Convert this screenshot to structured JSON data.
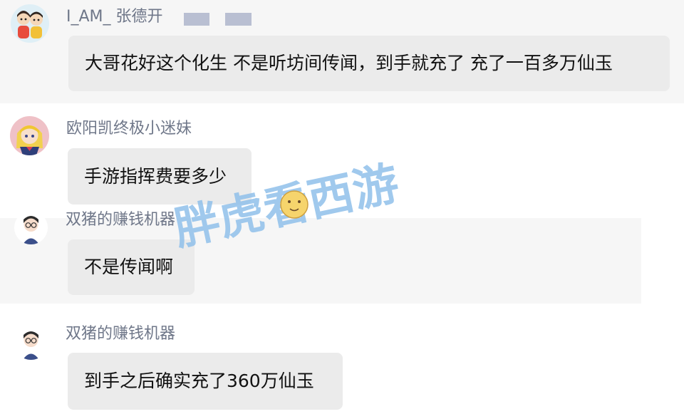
{
  "messages": [
    {
      "sender": "I_AM_ 张德开",
      "text": "大哥花好这个化生 不是听坊间传闻，到手就充了 充了一百多万仙玉"
    },
    {
      "sender": "欧阳凯终极小迷妹",
      "text": "手游指挥费要多少"
    },
    {
      "sender": "双猪的赚钱机器",
      "text": "不是传闻啊"
    },
    {
      "sender": "双猪的赚钱机器",
      "text": "到手之后确实充了360万仙玉"
    }
  ],
  "watermark": {
    "text": "胖虎看西游"
  },
  "colors": {
    "name": "#6f7789",
    "bubble": "#ebebeb",
    "row_background": "#f6f6f6",
    "watermark": "#8fc0ea",
    "redaction": "#b9bfd2"
  },
  "icons": [
    "kids-avatar-icon",
    "anime-girl-avatar-icon",
    "glasses-boy-avatar-icon",
    "glasses-boy-avatar-icon"
  ]
}
